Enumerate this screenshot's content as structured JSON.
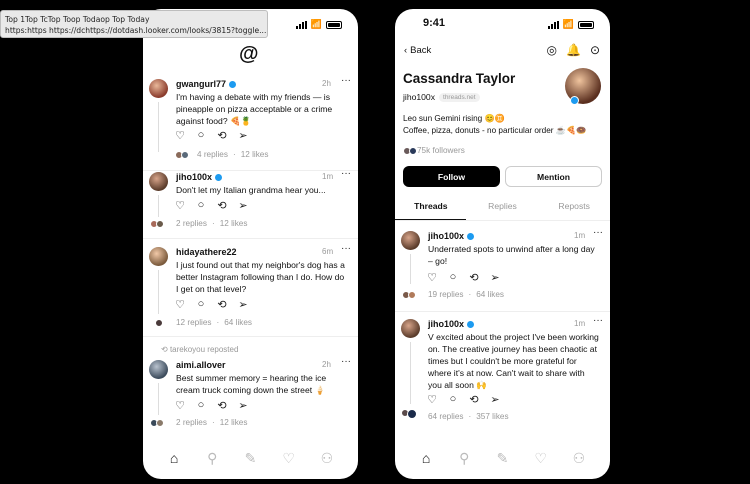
{
  "tooltip": {
    "line1": "Top 1Top TcTop Toop Todaop Top Today",
    "line2": "https:https https://dchttps://dotdash.looker.com/looks/3815?toggle..."
  },
  "left_phone": {
    "status_time": "",
    "logo_icon": "threads-logo-icon",
    "posts": [
      {
        "username": "gwangurl77",
        "time": "2h",
        "text": "I'm having a debate with my friends — is pineapple on pizza acceptable or a crime against food? 🍕🍍",
        "replies": "4 replies",
        "likes": "12 likes"
      },
      {
        "username": "jiho100x",
        "time": "1m",
        "text": "Don't let my Italian grandma hear you...",
        "replies": "2 replies",
        "likes": "12 likes"
      },
      {
        "username": "hidayathere22",
        "time": "6m",
        "text": "I just found out that my neighbor's dog has a better Instagram following than I do. How do I get on that level?",
        "replies": "12 replies",
        "likes": "64 likes"
      },
      {
        "repost_note": "tarekoyou reposted",
        "username": "aimi.allover",
        "time": "2h",
        "text": "Best summer memory = hearing the ice cream truck coming down the street 🍦",
        "replies": "2 replies",
        "likes": "12 likes"
      }
    ]
  },
  "right_phone": {
    "status_time": "9:41",
    "back_label": "Back",
    "profile": {
      "name": "Cassandra Taylor",
      "handle": "jiho100x",
      "handle_badge": "threads.net",
      "bio_line1": "Leo sun Gemini rising 😊♊",
      "bio_line2": "Coffee, pizza, donuts - no particular order ☕🍕🍩",
      "followers": "75k followers",
      "follow_label": "Follow",
      "mention_label": "Mention"
    },
    "tabs": [
      "Threads",
      "Replies",
      "Reposts"
    ],
    "posts": [
      {
        "username": "jiho100x",
        "time": "1m",
        "text": "Underrated spots to unwind after a long day – go!",
        "replies": "19 replies",
        "likes": "64 likes"
      },
      {
        "username": "jiho100x",
        "time": "1m",
        "text": "V excited about the project I've been working on. The creative journey has been chaotic at times but I couldn't be more grateful for where it's at now. Can't wait to share with you all soon 🙌",
        "replies": "64 replies",
        "likes": "357 likes"
      }
    ]
  },
  "icons": {
    "like": "heart-icon",
    "reply": "comment-icon",
    "repost": "repost-icon",
    "share": "send-icon",
    "nav": [
      "home-icon",
      "search-icon",
      "compose-icon",
      "activity-heart-icon",
      "profile-icon"
    ]
  },
  "colors": {
    "verified": "#1d9bf0",
    "background": "#000000"
  }
}
